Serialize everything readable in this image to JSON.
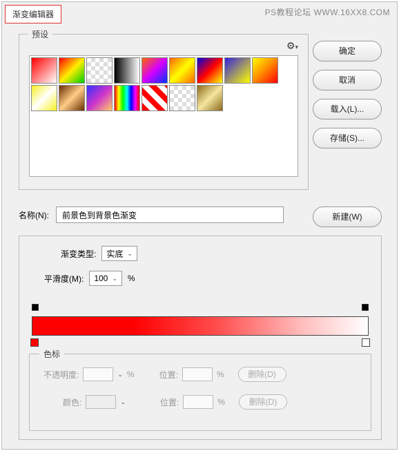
{
  "watermark": "PS教程论坛 WWW.16XX8.COM",
  "title": "渐变编辑器",
  "presets": {
    "label": "预设",
    "gear_name": "gear-icon"
  },
  "buttons": {
    "ok": "确定",
    "cancel": "取消",
    "load": "载入(L)...",
    "save": "存储(S)...",
    "new": "新建(W)"
  },
  "name_field": {
    "label": "名称(N):",
    "value": "前景色到背景色渐变"
  },
  "gradient": {
    "type_label": "渐变类型:",
    "type_value": "实底",
    "smooth_label": "平滑度(M):",
    "smooth_value": "100",
    "percent": "%"
  },
  "stops": {
    "legend": "色标",
    "opacity_label": "不透明度:",
    "position_label": "位置:",
    "delete_label": "删除(D)",
    "color_label": "颜色:"
  }
}
